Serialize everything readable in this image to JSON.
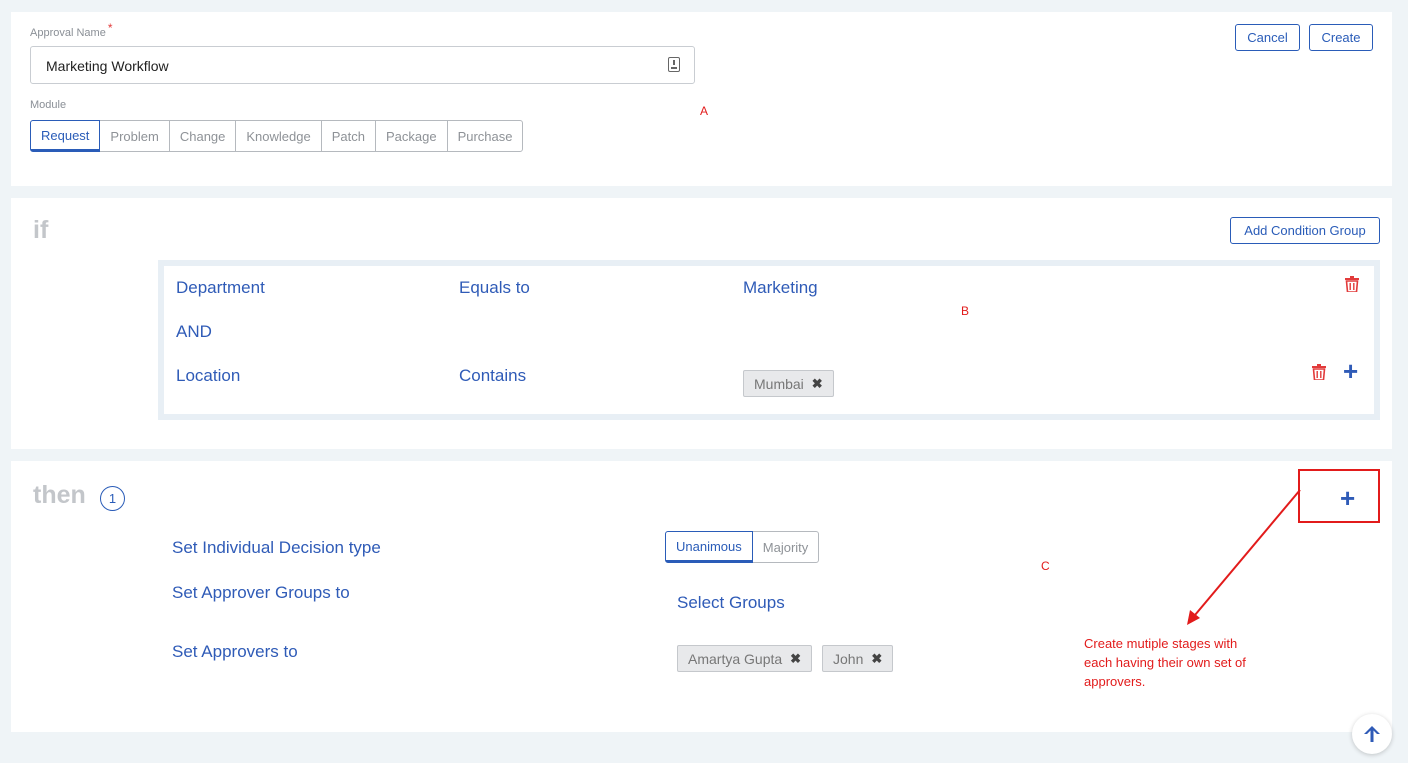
{
  "form": {
    "approval_name_label": "Approval Name",
    "required_mark": "*",
    "approval_name_value": "Marketing Workflow",
    "module_label": "Module",
    "modules": [
      "Request",
      "Problem",
      "Change",
      "Knowledge",
      "Patch",
      "Package",
      "Purchase"
    ],
    "selected_module": "Request",
    "cancel_label": "Cancel",
    "create_label": "Create"
  },
  "if_section": {
    "keyword": "if",
    "add_condition_group_label": "Add Condition Group",
    "conditions": [
      {
        "field": "Department",
        "operator": "Equals to",
        "value": "Marketing"
      },
      {
        "field": "Location",
        "operator": "Contains",
        "chips": [
          "Mumbai"
        ]
      }
    ],
    "joiner": "AND"
  },
  "then_section": {
    "keyword": "then",
    "stage_number": "1",
    "decision_type_label": "Set Individual Decision type",
    "decision_options": [
      "Unanimous",
      "Majority"
    ],
    "selected_decision": "Unanimous",
    "approver_groups_label": "Set Approver Groups to",
    "approver_groups_value": "Select Groups",
    "approvers_label": "Set Approvers to",
    "approvers": [
      "Amartya Gupta",
      "John"
    ]
  },
  "annotations": {
    "a": "A",
    "b": "B",
    "c": "C",
    "note_line1": "Create mutiple stages with",
    "note_line2": "each having their own set of",
    "note_line3": "approvers."
  },
  "icons": {
    "remove_chip": "✖",
    "add": "+"
  },
  "colors": {
    "accent": "#2a5cb8",
    "annotation": "#e21b1b",
    "delete": "#e23b3b"
  }
}
